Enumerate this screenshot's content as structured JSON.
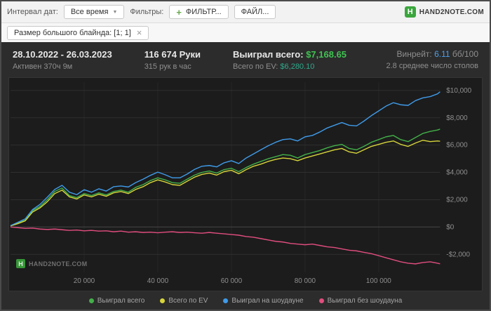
{
  "topbar": {
    "date_interval_label": "Интервал дат:",
    "date_interval_value": "Все время",
    "filters_label": "Фильтры:",
    "add_filter_button": "ФИЛЬТР...",
    "file_button": "ФАЙЛ...",
    "logo_text": "HAND2NOTE.COM"
  },
  "filter_chip": {
    "label": "Размер большого блайнда: [1; 1]",
    "close": "×"
  },
  "stats": {
    "date_range": "28.10.2022 - 26.03.2023",
    "active_time": "Активен 370ч 9м",
    "hands": "116 674 Руки",
    "hands_per_hour": "315 рук в час",
    "won_total_label": "Выиграл всего:",
    "won_total_value": "$7,168.65",
    "ev_total_label": "Всего по EV:",
    "ev_total_value": "$6,280.10",
    "winrate_label": "Винрейт:",
    "winrate_value": "6.11",
    "winrate_units": "бб/100",
    "avg_tables": "2.8 среднее число столов"
  },
  "watermark": "HAND2NOTE.COM",
  "colors": {
    "won_green": "#3fc351",
    "ev_teal": "#2fa98c",
    "winrate_blue": "#4d9fec",
    "brand_green": "#3aa63c"
  },
  "chart_data": {
    "type": "line",
    "title": "",
    "xlabel": "",
    "ylabel": "",
    "xlim": [
      0,
      116674
    ],
    "ylim": [
      -3300,
      10600
    ],
    "grid": true,
    "legend_position": "bottom",
    "x_ticks": [
      {
        "v": 20000,
        "label": "20 000"
      },
      {
        "v": 40000,
        "label": "40 000"
      },
      {
        "v": 60000,
        "label": "60 000"
      },
      {
        "v": 80000,
        "label": "80 000"
      },
      {
        "v": 100000,
        "label": "100 000"
      }
    ],
    "y_ticks": [
      {
        "v": 10000,
        "label": "$10,000"
      },
      {
        "v": 8000,
        "label": "$8,000"
      },
      {
        "v": 6000,
        "label": "$6,000"
      },
      {
        "v": 4000,
        "label": "$4,000"
      },
      {
        "v": 2000,
        "label": "$2,000"
      },
      {
        "v": 0,
        "label": "$0"
      },
      {
        "v": -2000,
        "label": "-$2,000"
      }
    ],
    "x": [
      0,
      2000,
      4000,
      6000,
      8000,
      10000,
      12000,
      14000,
      16000,
      18000,
      20000,
      22000,
      24000,
      26000,
      28000,
      30000,
      32000,
      34000,
      36000,
      38000,
      40000,
      42000,
      44000,
      46000,
      48000,
      50000,
      52000,
      54000,
      56000,
      58000,
      60000,
      62000,
      64000,
      66000,
      68000,
      70000,
      72000,
      74000,
      76000,
      78000,
      80000,
      82000,
      84000,
      86000,
      88000,
      90000,
      92000,
      94000,
      96000,
      98000,
      100000,
      102000,
      104000,
      106000,
      108000,
      110000,
      112000,
      114000,
      116000,
      116674
    ],
    "series": [
      {
        "name": "Выиграл всего",
        "color": "#43b049",
        "final_value": 7168.65,
        "values": [
          100,
          300,
          500,
          1200,
          1500,
          2000,
          2600,
          2850,
          2300,
          2150,
          2450,
          2300,
          2500,
          2350,
          2600,
          2700,
          2550,
          2900,
          3100,
          3400,
          3600,
          3450,
          3250,
          3200,
          3500,
          3800,
          4000,
          4100,
          3950,
          4200,
          4300,
          4050,
          4350,
          4600,
          4800,
          5000,
          5150,
          5300,
          5250,
          5050,
          5300,
          5450,
          5600,
          5800,
          5950,
          6050,
          5750,
          5650,
          5900,
          6200,
          6400,
          6600,
          6700,
          6400,
          6250,
          6550,
          6850,
          7000,
          7100,
          7168.65
        ]
      },
      {
        "name": "Всего по EV",
        "color": "#d6d43b",
        "final_value": 6280.1,
        "values": [
          80,
          250,
          450,
          1100,
          1400,
          1850,
          2450,
          2700,
          2200,
          2050,
          2350,
          2200,
          2400,
          2250,
          2500,
          2600,
          2450,
          2750,
          2950,
          3250,
          3450,
          3300,
          3100,
          3050,
          3350,
          3650,
          3850,
          3950,
          3800,
          4050,
          4150,
          3900,
          4200,
          4450,
          4600,
          4800,
          4950,
          5050,
          5000,
          4850,
          5050,
          5200,
          5350,
          5500,
          5650,
          5750,
          5500,
          5400,
          5650,
          5900,
          6050,
          6200,
          6300,
          6050,
          5900,
          6150,
          6350,
          6250,
          6300,
          6280.1
        ]
      },
      {
        "name": "Выиграл на шоудауне",
        "color": "#3f9bea",
        "final_value": 9900,
        "values": [
          100,
          350,
          600,
          1280,
          1650,
          2180,
          2750,
          3050,
          2550,
          2370,
          2730,
          2550,
          2800,
          2630,
          2950,
          3000,
          2930,
          3250,
          3500,
          3780,
          4020,
          3830,
          3600,
          3600,
          3880,
          4220,
          4450,
          4500,
          4400,
          4700,
          4850,
          4650,
          5050,
          5350,
          5650,
          5950,
          6200,
          6400,
          6450,
          6300,
          6600,
          6700,
          6950,
          7250,
          7450,
          7650,
          7450,
          7400,
          7750,
          8150,
          8500,
          8850,
          9100,
          8950,
          8900,
          9250,
          9450,
          9550,
          9750,
          9900
        ]
      },
      {
        "name": "Выиграл без шоудауна",
        "color": "#e14d7e",
        "final_value": -2700,
        "values": [
          0,
          -50,
          -100,
          -80,
          -150,
          -180,
          -150,
          -200,
          -250,
          -220,
          -280,
          -250,
          -300,
          -280,
          -350,
          -300,
          -380,
          -350,
          -400,
          -380,
          -420,
          -380,
          -350,
          -400,
          -380,
          -420,
          -450,
          -400,
          -450,
          -500,
          -550,
          -600,
          -700,
          -750,
          -850,
          -950,
          -1050,
          -1100,
          -1200,
          -1250,
          -1300,
          -1250,
          -1350,
          -1450,
          -1500,
          -1600,
          -1700,
          -1750,
          -1850,
          -1950,
          -2100,
          -2250,
          -2400,
          -2550,
          -2650,
          -2700,
          -2600,
          -2550,
          -2650,
          -2700
        ]
      }
    ]
  }
}
